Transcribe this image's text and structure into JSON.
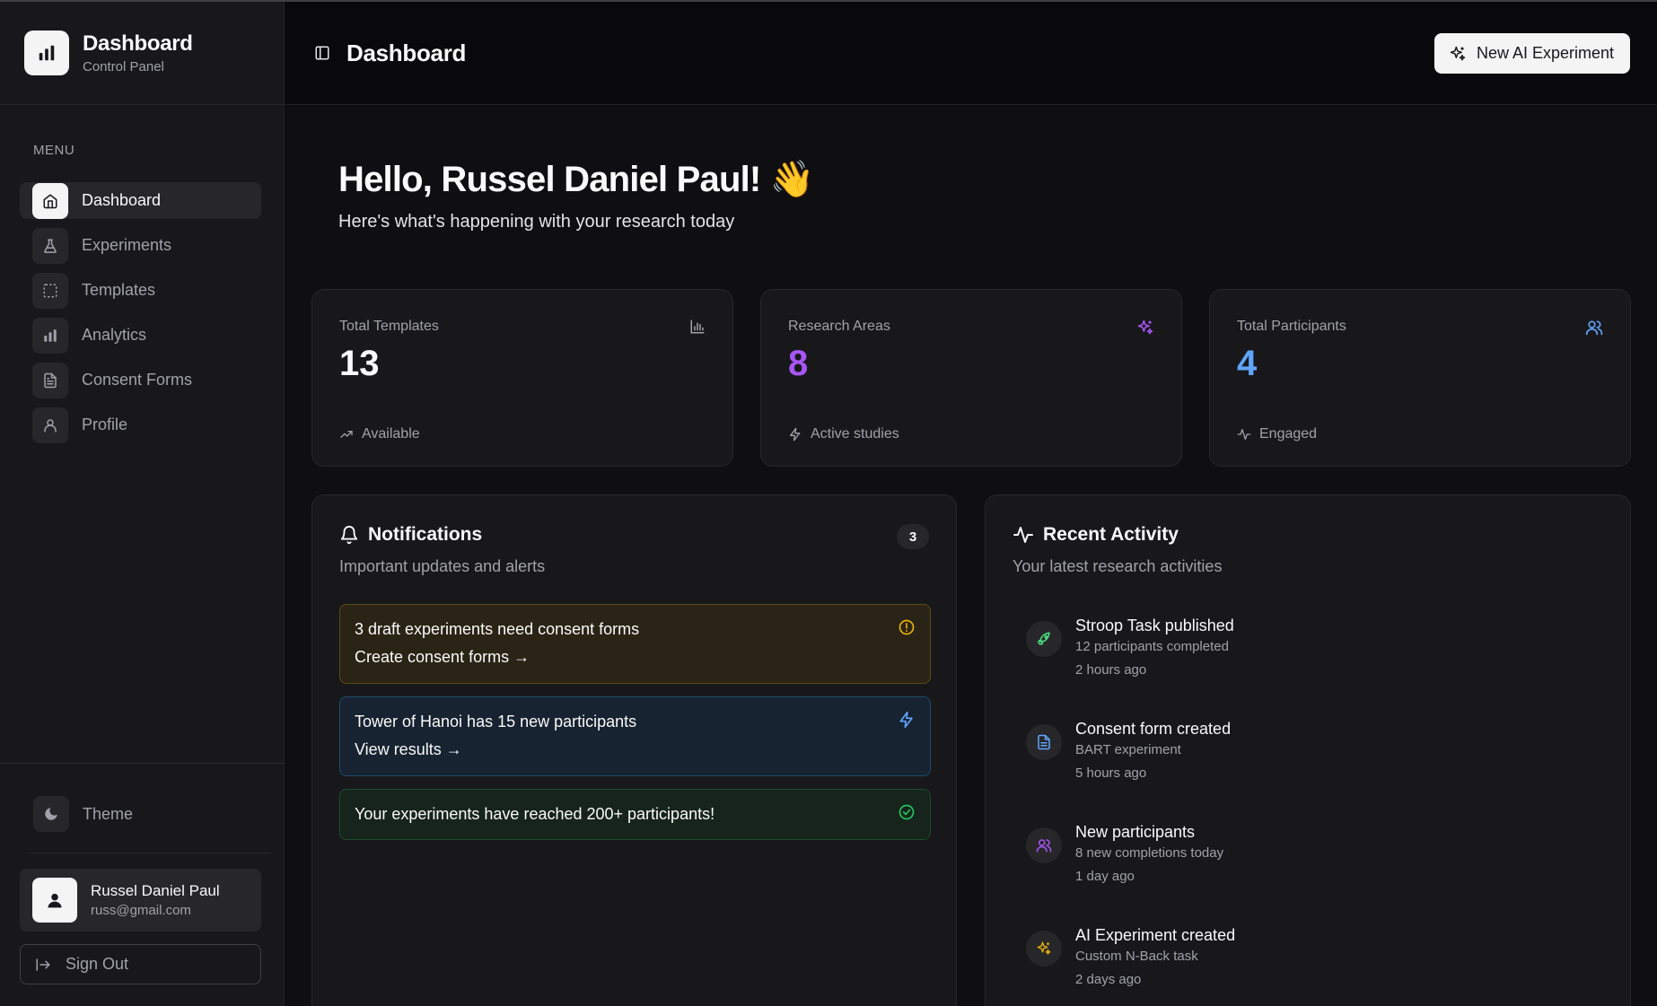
{
  "sidebar": {
    "brand_title": "Dashboard",
    "brand_subtitle": "Control Panel",
    "menu_label": "MENU",
    "items": [
      {
        "label": "Dashboard",
        "icon": "home-icon"
      },
      {
        "label": "Experiments",
        "icon": "flask-icon"
      },
      {
        "label": "Templates",
        "icon": "dashed-square-icon"
      },
      {
        "label": "Analytics",
        "icon": "bar-chart-icon"
      },
      {
        "label": "Consent Forms",
        "icon": "file-text-icon"
      },
      {
        "label": "Profile",
        "icon": "user-icon"
      }
    ],
    "theme_label": "Theme",
    "user": {
      "name": "Russel Daniel Paul",
      "email": "russ@gmail.com"
    },
    "signout_label": "Sign Out"
  },
  "header": {
    "title": "Dashboard",
    "new_ai_label": "New AI Experiment"
  },
  "greeting": {
    "title": "Hello, Russel Daniel Paul! 👋",
    "subtitle": "Here's what's happening with your research today"
  },
  "stats": [
    {
      "label": "Total Templates",
      "value": "13",
      "footer": "Available",
      "color": "#fafafa"
    },
    {
      "label": "Research Areas",
      "value": "8",
      "footer": "Active studies",
      "color": "#a855f7"
    },
    {
      "label": "Total Participants",
      "value": "4",
      "footer": "Engaged",
      "color": "#60a5fa"
    }
  ],
  "notifications": {
    "title": "Notifications",
    "subtitle": "Important updates and alerts",
    "count": "3",
    "items": [
      {
        "text": "3 draft experiments need consent forms",
        "link": "Create consent forms →",
        "color": "#eab308"
      },
      {
        "text": "Tower of Hanoi has 15 new participants",
        "link": "View results →",
        "color": "#60a5fa"
      },
      {
        "text": "Your experiments have reached 200+ participants!",
        "color": "#22c55e"
      }
    ]
  },
  "activity": {
    "title": "Recent Activity",
    "subtitle": "Your latest research activities",
    "items": [
      {
        "title": "Stroop Task published",
        "desc": "12 participants completed",
        "time": "2 hours ago",
        "icon": "rocket-icon",
        "color": "#4ade80"
      },
      {
        "title": "Consent form created",
        "desc": "BART experiment",
        "time": "5 hours ago",
        "icon": "file-text-icon",
        "color": "#60a5fa"
      },
      {
        "title": "New participants",
        "desc": "8 new completions today",
        "time": "1 day ago",
        "icon": "users-icon",
        "color": "#a855f7"
      },
      {
        "title": "AI Experiment created",
        "desc": "Custom N-Back task",
        "time": "2 days ago",
        "icon": "sparkles-icon",
        "color": "#eab308"
      }
    ]
  }
}
